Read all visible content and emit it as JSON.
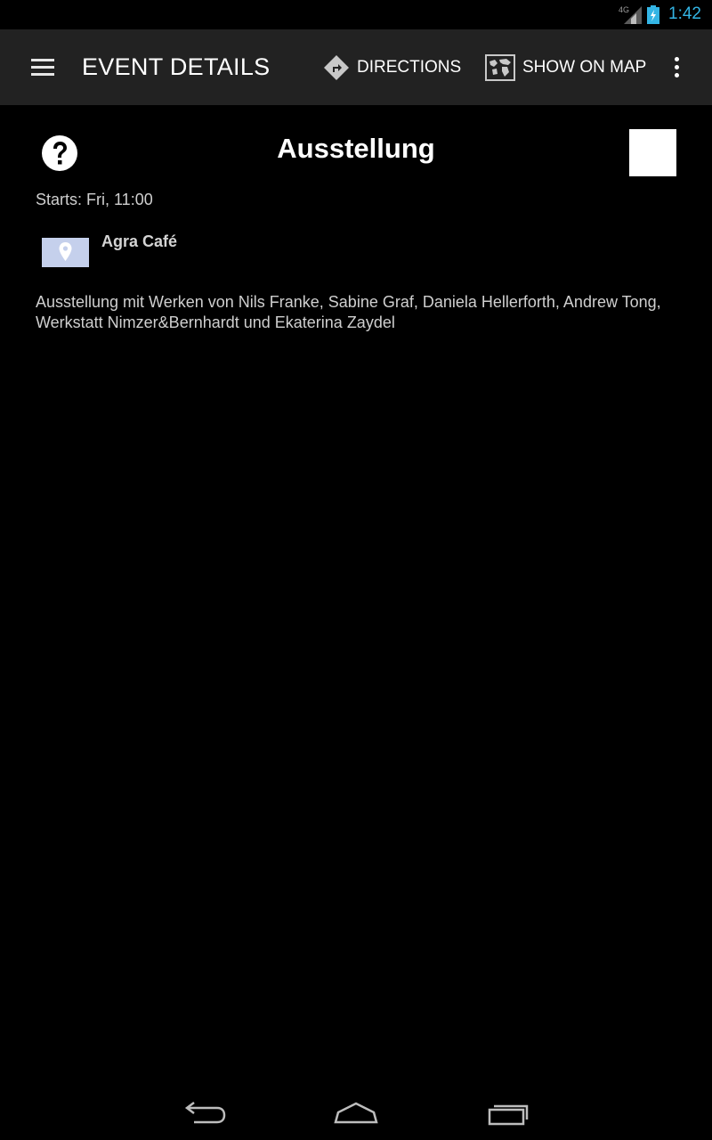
{
  "status_bar": {
    "network_label": "4G",
    "time": "1:42",
    "time_color": "#33b5e5"
  },
  "action_bar": {
    "title": "EVENT DETAILS",
    "directions_label": "DIRECTIONS",
    "show_on_map_label": "SHOW ON MAP",
    "background": "#222222"
  },
  "event": {
    "title": "Ausstellung",
    "starts": "Starts: Fri, 11:00",
    "venue": "Agra Café",
    "description": "Ausstellung mit Werken von Nils Franke, Sabine Graf, Daniela Hellerforth, Andrew Tong, Werkstatt Nimzer&Bernhardt und Ekaterina Zaydel"
  },
  "icons": {
    "menu": "hamburger-menu-icon",
    "directions": "directions-icon",
    "map": "map-icon",
    "overflow": "overflow-menu-icon",
    "help": "question-mark-icon",
    "location": "location-pin-icon",
    "back": "back-icon",
    "home": "home-icon",
    "recent": "recent-apps-icon"
  }
}
